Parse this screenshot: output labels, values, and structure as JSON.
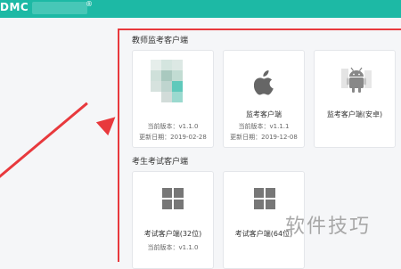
{
  "header": {
    "brand_text": "DMC",
    "brand_mark": "®",
    "bar_color": "#1db9a5"
  },
  "teacher_section": {
    "title": "教师监考客户端",
    "cards": [
      {
        "name": "",
        "version": "当前版本：v1.1.0",
        "date": "更新日期：2019-02-28",
        "icon": "blurred-app-icon"
      },
      {
        "name": "监考客户端",
        "version": "当前版本：v1.1.1",
        "date": "更新日期：2019-12-08",
        "icon": "apple-icon"
      },
      {
        "name": "监考客户端(安卓)",
        "version": "",
        "date": "",
        "icon": "android-icon"
      }
    ]
  },
  "student_section": {
    "title": "考生考试客户端",
    "cards": [
      {
        "name": "考试客户端(32位)",
        "version": "当前版本：v1.1.0",
        "date": "",
        "icon": "windows-icon"
      },
      {
        "name": "考试客户端(64位)",
        "version": "",
        "date": "",
        "icon": "windows-icon"
      }
    ]
  },
  "watermark": "软件技巧",
  "highlight_color": "#e8393d"
}
